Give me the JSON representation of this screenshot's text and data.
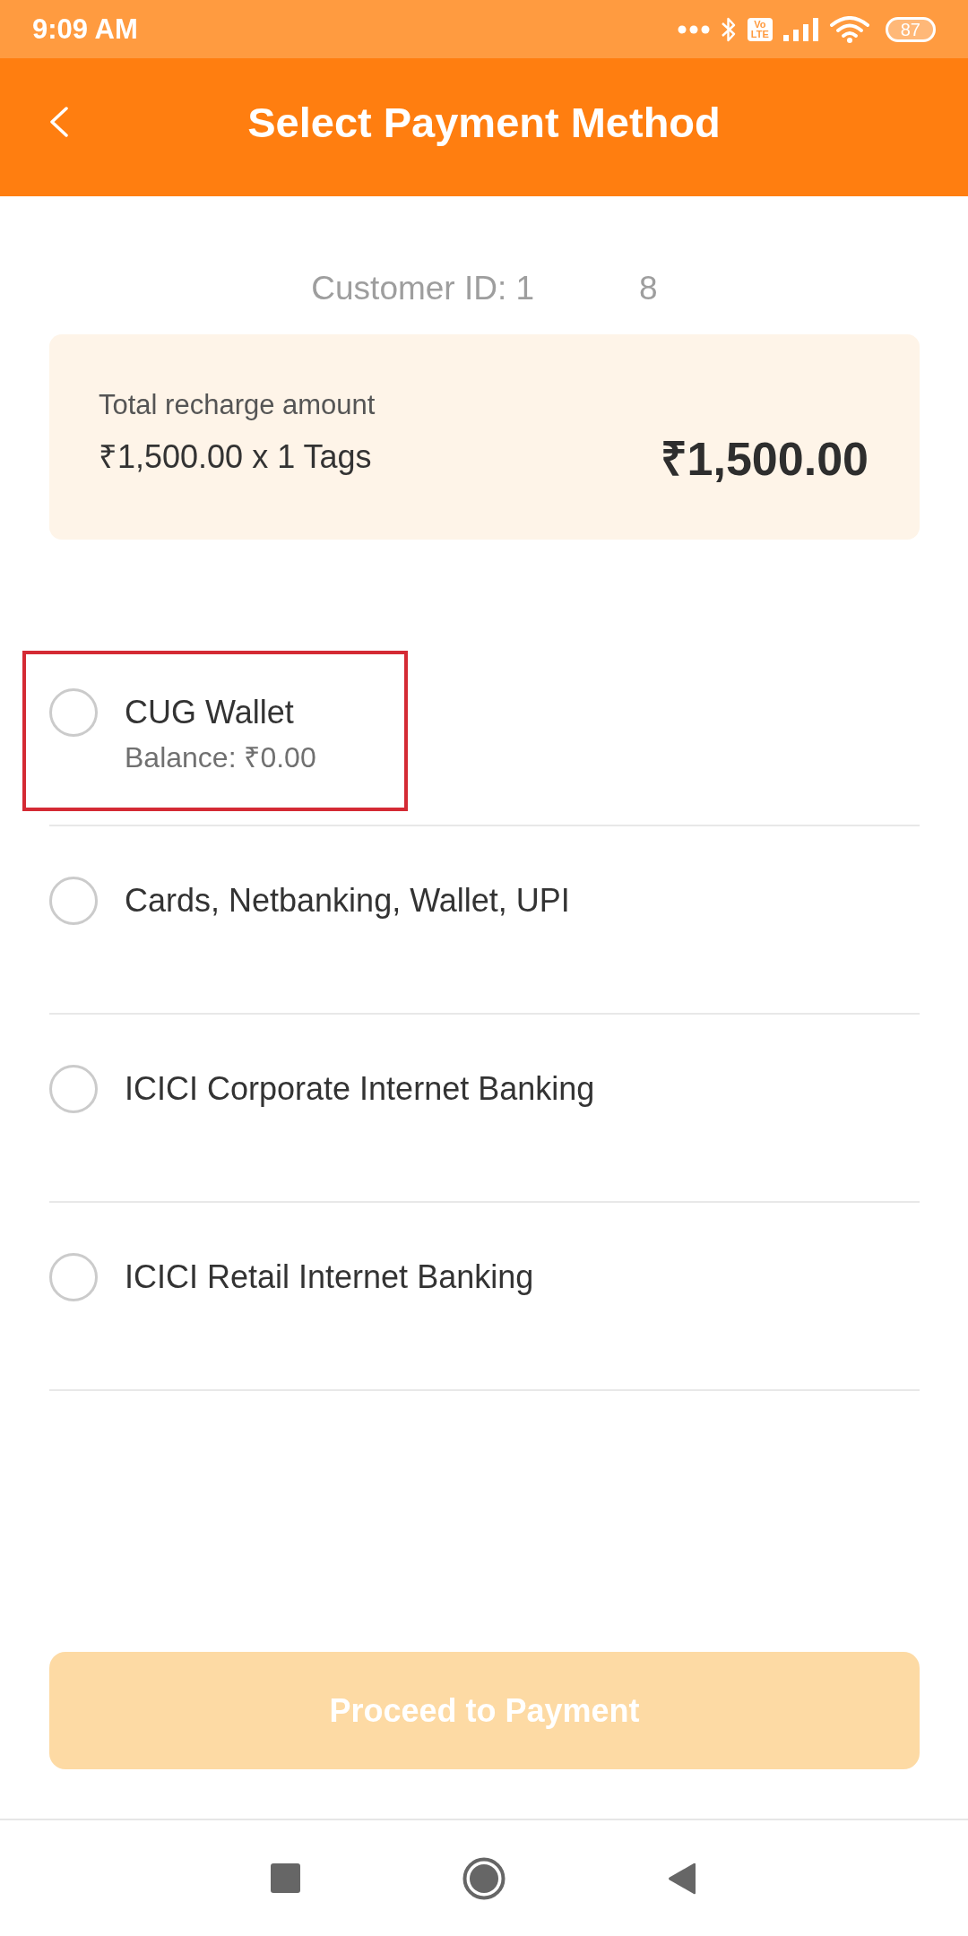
{
  "status_bar": {
    "time": "9:09 AM",
    "network_badge": "Vo LTE",
    "battery": "87"
  },
  "header": {
    "title": "Select Payment Method"
  },
  "customer_id": [
    "Customer ID: 1",
    "8"
  ],
  "summary": {
    "label": "Total recharge amount",
    "detail": "₹1,500.00 x 1 Tags",
    "total": "₹1,500.00"
  },
  "payment_options": [
    {
      "label": "CUG Wallet",
      "sublabel": "Balance: ₹0.00",
      "selected": false,
      "highlighted": true
    },
    {
      "label": "Cards, Netbanking, Wallet, UPI",
      "selected": false,
      "highlighted": false
    },
    {
      "label": "ICICI Corporate Internet Banking",
      "selected": false,
      "highlighted": false
    },
    {
      "label": "ICICI Retail Internet Banking",
      "selected": false,
      "highlighted": false
    }
  ],
  "proceed_button": {
    "label": "Proceed to Payment",
    "disabled": true
  }
}
